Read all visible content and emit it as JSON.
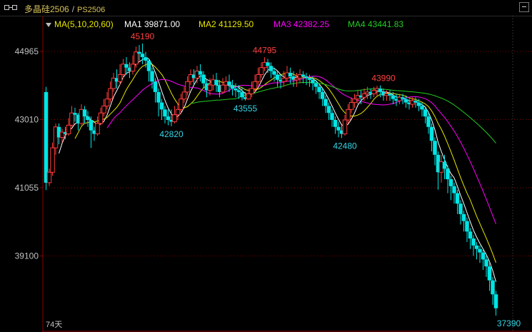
{
  "ticker": {
    "name": "多晶硅2506",
    "separator": "/",
    "code": "PS2506"
  },
  "colors": {
    "up": "#ff3b3b",
    "down": "#00e5e5",
    "ma1": "#ffffff",
    "ma2": "#e6e600",
    "ma3": "#ff00ff",
    "ma4": "#22cc22",
    "axis": "#8a0000",
    "label": "#c0c0c0"
  },
  "legend": {
    "params": "MA(5,10,20,60)",
    "ma1": "MA1 39871.00",
    "ma2": "MA2 41129.50",
    "ma3": "MA3 42382.25",
    "ma4": "MA4 43441.83"
  },
  "chart_data": {
    "type": "candlestick",
    "yticks": [
      44965,
      43010,
      41055,
      39100
    ],
    "ylim": [
      37390,
      45190
    ],
    "period_label": "74天",
    "annotations": [
      {
        "text": "45190",
        "index": 30,
        "value": 45190,
        "kind": "high"
      },
      {
        "text": "44795",
        "index": 68,
        "value": 44795,
        "kind": "high"
      },
      {
        "text": "43990",
        "index": 105,
        "value": 43990,
        "kind": "high"
      },
      {
        "text": "42820",
        "index": 39,
        "value": 42820,
        "kind": "low"
      },
      {
        "text": "43555",
        "index": 62,
        "value": 43555,
        "kind": "low"
      },
      {
        "text": "42480",
        "index": 93,
        "value": 42480,
        "kind": "low"
      },
      {
        "text": "37390",
        "index": 144,
        "value": 37390,
        "kind": "low"
      }
    ],
    "candles": [
      [
        43800,
        41200,
        43950,
        40990
      ],
      [
        41200,
        41500,
        41600,
        41100
      ],
      [
        41500,
        42200,
        42350,
        41400
      ],
      [
        42200,
        42800,
        42900,
        42000
      ],
      [
        42800,
        42500,
        42900,
        42300
      ],
      [
        42500,
        42650,
        42750,
        42350
      ],
      [
        42650,
        42600,
        42800,
        42450
      ],
      [
        42600,
        42850,
        43050,
        42550
      ],
      [
        42850,
        43200,
        43400,
        42800
      ],
      [
        43200,
        43150,
        43350,
        42950
      ],
      [
        43150,
        42900,
        43200,
        42700
      ],
      [
        42900,
        43300,
        43450,
        42850
      ],
      [
        43300,
        43100,
        43400,
        42900
      ],
      [
        43100,
        43000,
        43250,
        42800
      ],
      [
        43000,
        42700,
        43100,
        42200
      ],
      [
        42700,
        42600,
        42800,
        42400
      ],
      [
        42600,
        42900,
        43100,
        42550
      ],
      [
        42900,
        43200,
        43350,
        42850
      ],
      [
        43200,
        43400,
        43600,
        43100
      ],
      [
        43400,
        43600,
        43800,
        43300
      ],
      [
        43600,
        43900,
        44100,
        43500
      ],
      [
        43900,
        44200,
        44350,
        43800
      ],
      [
        44200,
        44100,
        44450,
        43900
      ],
      [
        44100,
        44300,
        44600,
        44000
      ],
      [
        44300,
        44600,
        44750,
        44200
      ],
      [
        44600,
        44500,
        44800,
        44300
      ],
      [
        44500,
        44400,
        44650,
        44200
      ],
      [
        44400,
        44600,
        44850,
        44300
      ],
      [
        44600,
        44950,
        45100,
        44500
      ],
      [
        44950,
        44900,
        45150,
        44700
      ],
      [
        44900,
        44800,
        45190,
        44600
      ],
      [
        44800,
        44700,
        44950,
        44500
      ],
      [
        44700,
        44400,
        44750,
        44100
      ],
      [
        44400,
        44100,
        44500,
        43900
      ],
      [
        44100,
        43800,
        44200,
        43500
      ],
      [
        43800,
        43500,
        43900,
        43100
      ],
      [
        43500,
        43300,
        43600,
        43000
      ],
      [
        43300,
        43100,
        43400,
        42900
      ],
      [
        43100,
        43000,
        43300,
        42850
      ],
      [
        43000,
        42950,
        43300,
        42820
      ],
      [
        42950,
        43150,
        43400,
        42900
      ],
      [
        43150,
        43300,
        43500,
        43000
      ],
      [
        43300,
        43600,
        43750,
        43200
      ],
      [
        43600,
        43800,
        43950,
        43500
      ],
      [
        43800,
        44100,
        44250,
        43700
      ],
      [
        44100,
        44300,
        44450,
        44000
      ],
      [
        44300,
        44200,
        44450,
        44000
      ],
      [
        44200,
        44400,
        44550,
        44050
      ],
      [
        44400,
        44300,
        44600,
        44100
      ],
      [
        44300,
        44050,
        44400,
        43900
      ],
      [
        44050,
        43850,
        44150,
        43650
      ],
      [
        43850,
        44000,
        44200,
        43700
      ],
      [
        44000,
        44150,
        44300,
        43850
      ],
      [
        44150,
        44000,
        44350,
        43800
      ],
      [
        44000,
        43800,
        44150,
        43650
      ],
      [
        43800,
        44000,
        44200,
        43750
      ],
      [
        44000,
        44100,
        44250,
        43850
      ],
      [
        44100,
        44000,
        44300,
        43800
      ],
      [
        44000,
        43900,
        44150,
        43700
      ],
      [
        43900,
        43850,
        44050,
        43650
      ],
      [
        43850,
        43800,
        44000,
        43600
      ],
      [
        43800,
        43650,
        43950,
        43560
      ],
      [
        43650,
        43600,
        43800,
        43555
      ],
      [
        43600,
        43750,
        43900,
        43580
      ],
      [
        43750,
        43900,
        44100,
        43650
      ],
      [
        43900,
        44100,
        44300,
        43800
      ],
      [
        44100,
        44300,
        44500,
        44000
      ],
      [
        44300,
        44500,
        44650,
        44200
      ],
      [
        44500,
        44650,
        44795,
        44400
      ],
      [
        44650,
        44550,
        44750,
        44350
      ],
      [
        44550,
        44400,
        44650,
        44200
      ],
      [
        44400,
        44300,
        44500,
        44100
      ],
      [
        44300,
        44150,
        44400,
        43950
      ],
      [
        44150,
        44100,
        44300,
        43900
      ],
      [
        44100,
        44200,
        44400,
        43950
      ],
      [
        44200,
        44350,
        44550,
        44100
      ],
      [
        44350,
        44250,
        44500,
        44050
      ],
      [
        44250,
        44150,
        44400,
        43950
      ],
      [
        44150,
        44200,
        44350,
        43950
      ],
      [
        44200,
        44300,
        44450,
        44050
      ],
      [
        44300,
        44250,
        44400,
        44050
      ],
      [
        44250,
        44200,
        44350,
        44000
      ],
      [
        44200,
        44150,
        44300,
        43950
      ],
      [
        44150,
        44050,
        44250,
        43850
      ],
      [
        44050,
        43950,
        44150,
        43750
      ],
      [
        43950,
        43800,
        44050,
        43600
      ],
      [
        43800,
        43600,
        43900,
        43400
      ],
      [
        43600,
        43400,
        43700,
        43200
      ],
      [
        43400,
        43200,
        43500,
        43000
      ],
      [
        43200,
        43000,
        43300,
        42800
      ],
      [
        43000,
        42800,
        43100,
        42600
      ],
      [
        42800,
        42700,
        42950,
        42500
      ],
      [
        42700,
        42600,
        42850,
        42480
      ],
      [
        42600,
        43000,
        43150,
        42550
      ],
      [
        43000,
        43300,
        43450,
        42900
      ],
      [
        43300,
        43500,
        43650,
        43200
      ],
      [
        43500,
        43600,
        43750,
        43350
      ],
      [
        43600,
        43700,
        43850,
        43450
      ],
      [
        43700,
        43650,
        43850,
        43450
      ],
      [
        43650,
        43750,
        43900,
        43550
      ],
      [
        43750,
        43800,
        43950,
        43600
      ],
      [
        43800,
        43750,
        43900,
        43600
      ],
      [
        43750,
        43850,
        43950,
        43650
      ],
      [
        43850,
        43900,
        43980,
        43700
      ],
      [
        43900,
        43800,
        43990,
        43650
      ],
      [
        43800,
        43700,
        43900,
        43550
      ],
      [
        43700,
        43750,
        43850,
        43550
      ],
      [
        43750,
        43700,
        43850,
        43550
      ],
      [
        43700,
        43600,
        43800,
        43450
      ],
      [
        43600,
        43550,
        43750,
        43400
      ],
      [
        43550,
        43650,
        43750,
        43450
      ],
      [
        43650,
        43600,
        43750,
        43450
      ],
      [
        43600,
        43500,
        43700,
        43350
      ],
      [
        43500,
        43450,
        43600,
        43300
      ],
      [
        43450,
        43550,
        43650,
        43350
      ],
      [
        43550,
        43500,
        43650,
        43350
      ],
      [
        43500,
        43400,
        43600,
        43250
      ],
      [
        43400,
        43300,
        43500,
        43100
      ],
      [
        43300,
        43100,
        43400,
        42900
      ],
      [
        43100,
        42800,
        43200,
        42600
      ],
      [
        42800,
        42400,
        42900,
        42100
      ],
      [
        42400,
        42000,
        42500,
        41700
      ],
      [
        42000,
        41500,
        42100,
        41000
      ],
      [
        41500,
        41800,
        42000,
        41200
      ],
      [
        41800,
        41600,
        42000,
        41300
      ],
      [
        41600,
        41300,
        41700,
        40900
      ],
      [
        41300,
        41100,
        41400,
        40700
      ],
      [
        41100,
        40900,
        41200,
        40600
      ],
      [
        40900,
        40600,
        41000,
        40300
      ],
      [
        40600,
        40300,
        40700,
        40000
      ],
      [
        40300,
        40100,
        40400,
        39800
      ],
      [
        40100,
        39800,
        40200,
        39500
      ],
      [
        39800,
        39600,
        39900,
        39300
      ],
      [
        39600,
        39400,
        39700,
        39100
      ],
      [
        39400,
        39300,
        39500,
        39000
      ],
      [
        39300,
        39200,
        39400,
        38900
      ],
      [
        39200,
        39000,
        39300,
        38700
      ],
      [
        39000,
        38800,
        39100,
        38500
      ],
      [
        38800,
        38400,
        38900,
        38100
      ],
      [
        38400,
        38000,
        38500,
        37700
      ],
      [
        38000,
        37600,
        38100,
        37390
      ]
    ]
  }
}
